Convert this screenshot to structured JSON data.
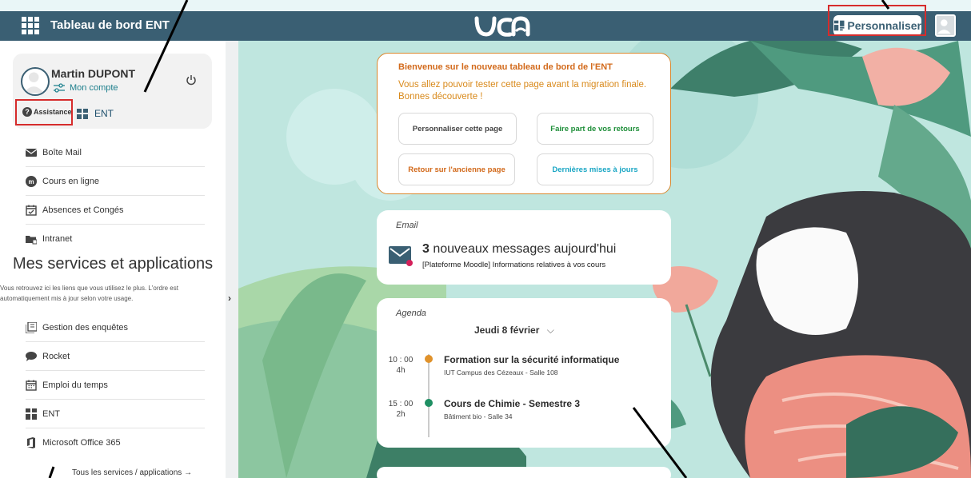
{
  "header": {
    "title": "Tableau de bord ENT",
    "personalize_label": "Personnaliser"
  },
  "profile": {
    "name": "Martin DUPONT",
    "account_label": "Mon compte",
    "assistance_label": "Assistance",
    "ent_label": "ENT"
  },
  "sidebar": {
    "quick_links": [
      {
        "label": "Boîte Mail",
        "icon": "mail-icon"
      },
      {
        "label": "Cours en ligne",
        "icon": "moodle-icon"
      },
      {
        "label": "Absences et Congés",
        "icon": "calendar-check-icon"
      },
      {
        "label": "Intranet",
        "icon": "folder-icon"
      }
    ],
    "section_title": "Mes services et applications",
    "section_desc": "Vous retrouvez ici les liens que vous utilisez le plus. L'ordre est automatiquement mis à jour selon votre usage.",
    "services": [
      {
        "label": "Gestion des enquêtes",
        "icon": "survey-icon"
      },
      {
        "label": "Rocket",
        "icon": "chat-icon"
      },
      {
        "label": "Emploi du temps",
        "icon": "calendar-icon"
      },
      {
        "label": "ENT",
        "icon": "ent-grid-icon"
      },
      {
        "label": "Microsoft Office 365",
        "icon": "office-icon"
      }
    ],
    "all_services_label": "Tous les services / applications →"
  },
  "welcome": {
    "title": "Bienvenue sur le nouveau tableau de bord de l'ENT",
    "text": "Vous allez pouvoir tester cette page avant la migration finale. Bonnes découverte !",
    "buttons": {
      "customize": "Personnaliser cette page",
      "feedback": "Faire part de vos retours",
      "old_page": "Retour sur l'ancienne page",
      "updates": "Dernières mises à jours"
    }
  },
  "email": {
    "label": "Email",
    "count": "3",
    "message": "nouveaux messages aujourd'hui",
    "latest": "[Plateforme Moodle] Informations relatives à vos cours"
  },
  "agenda": {
    "label": "Agenda",
    "date": "Jeudi 8 février",
    "events": [
      {
        "time": "10 : 00",
        "duration": "4h",
        "title": "Formation sur la sécurité informatique",
        "place": "IUT Campus des Cézeaux - Salle 108",
        "color": "#e0922b"
      },
      {
        "time": "15 : 00",
        "duration": "2h",
        "title": "Cours de Chimie - Semestre 3",
        "place": "Bâtiment bio - Salle 34",
        "color": "#1f8f63"
      }
    ]
  },
  "colors": {
    "header": "#3a5f73",
    "accent_orange": "#d9862c",
    "accent_green": "#1f8f63",
    "accent_cyan": "#1aa6c4",
    "highlight_red": "#d62c2c"
  }
}
